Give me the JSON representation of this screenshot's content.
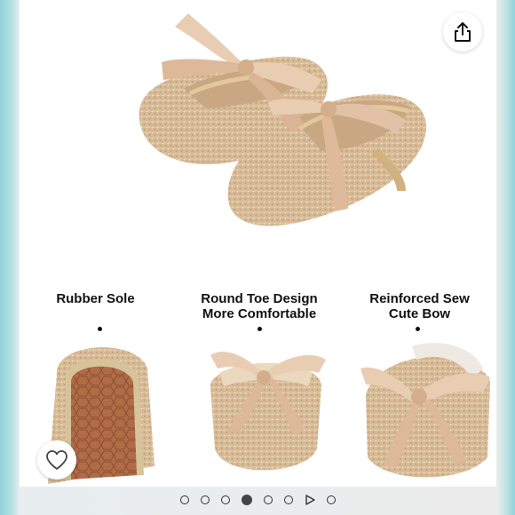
{
  "features": [
    {
      "line1": "Rubber Sole",
      "line2": ""
    },
    {
      "line1": "Round Toe Design",
      "line2": "More Comfortable"
    },
    {
      "line1": "Reinforced Sew",
      "line2": "Cute Bow"
    }
  ],
  "icons": {
    "share": "share-icon",
    "like": "heart-icon",
    "video": "play-icon"
  },
  "gallery": {
    "total_slides": 7,
    "active_index": 3
  },
  "colors": {
    "glitter": "#d9bd9a",
    "ribbon": "#e9cdb2",
    "sole": "#b5704a"
  }
}
